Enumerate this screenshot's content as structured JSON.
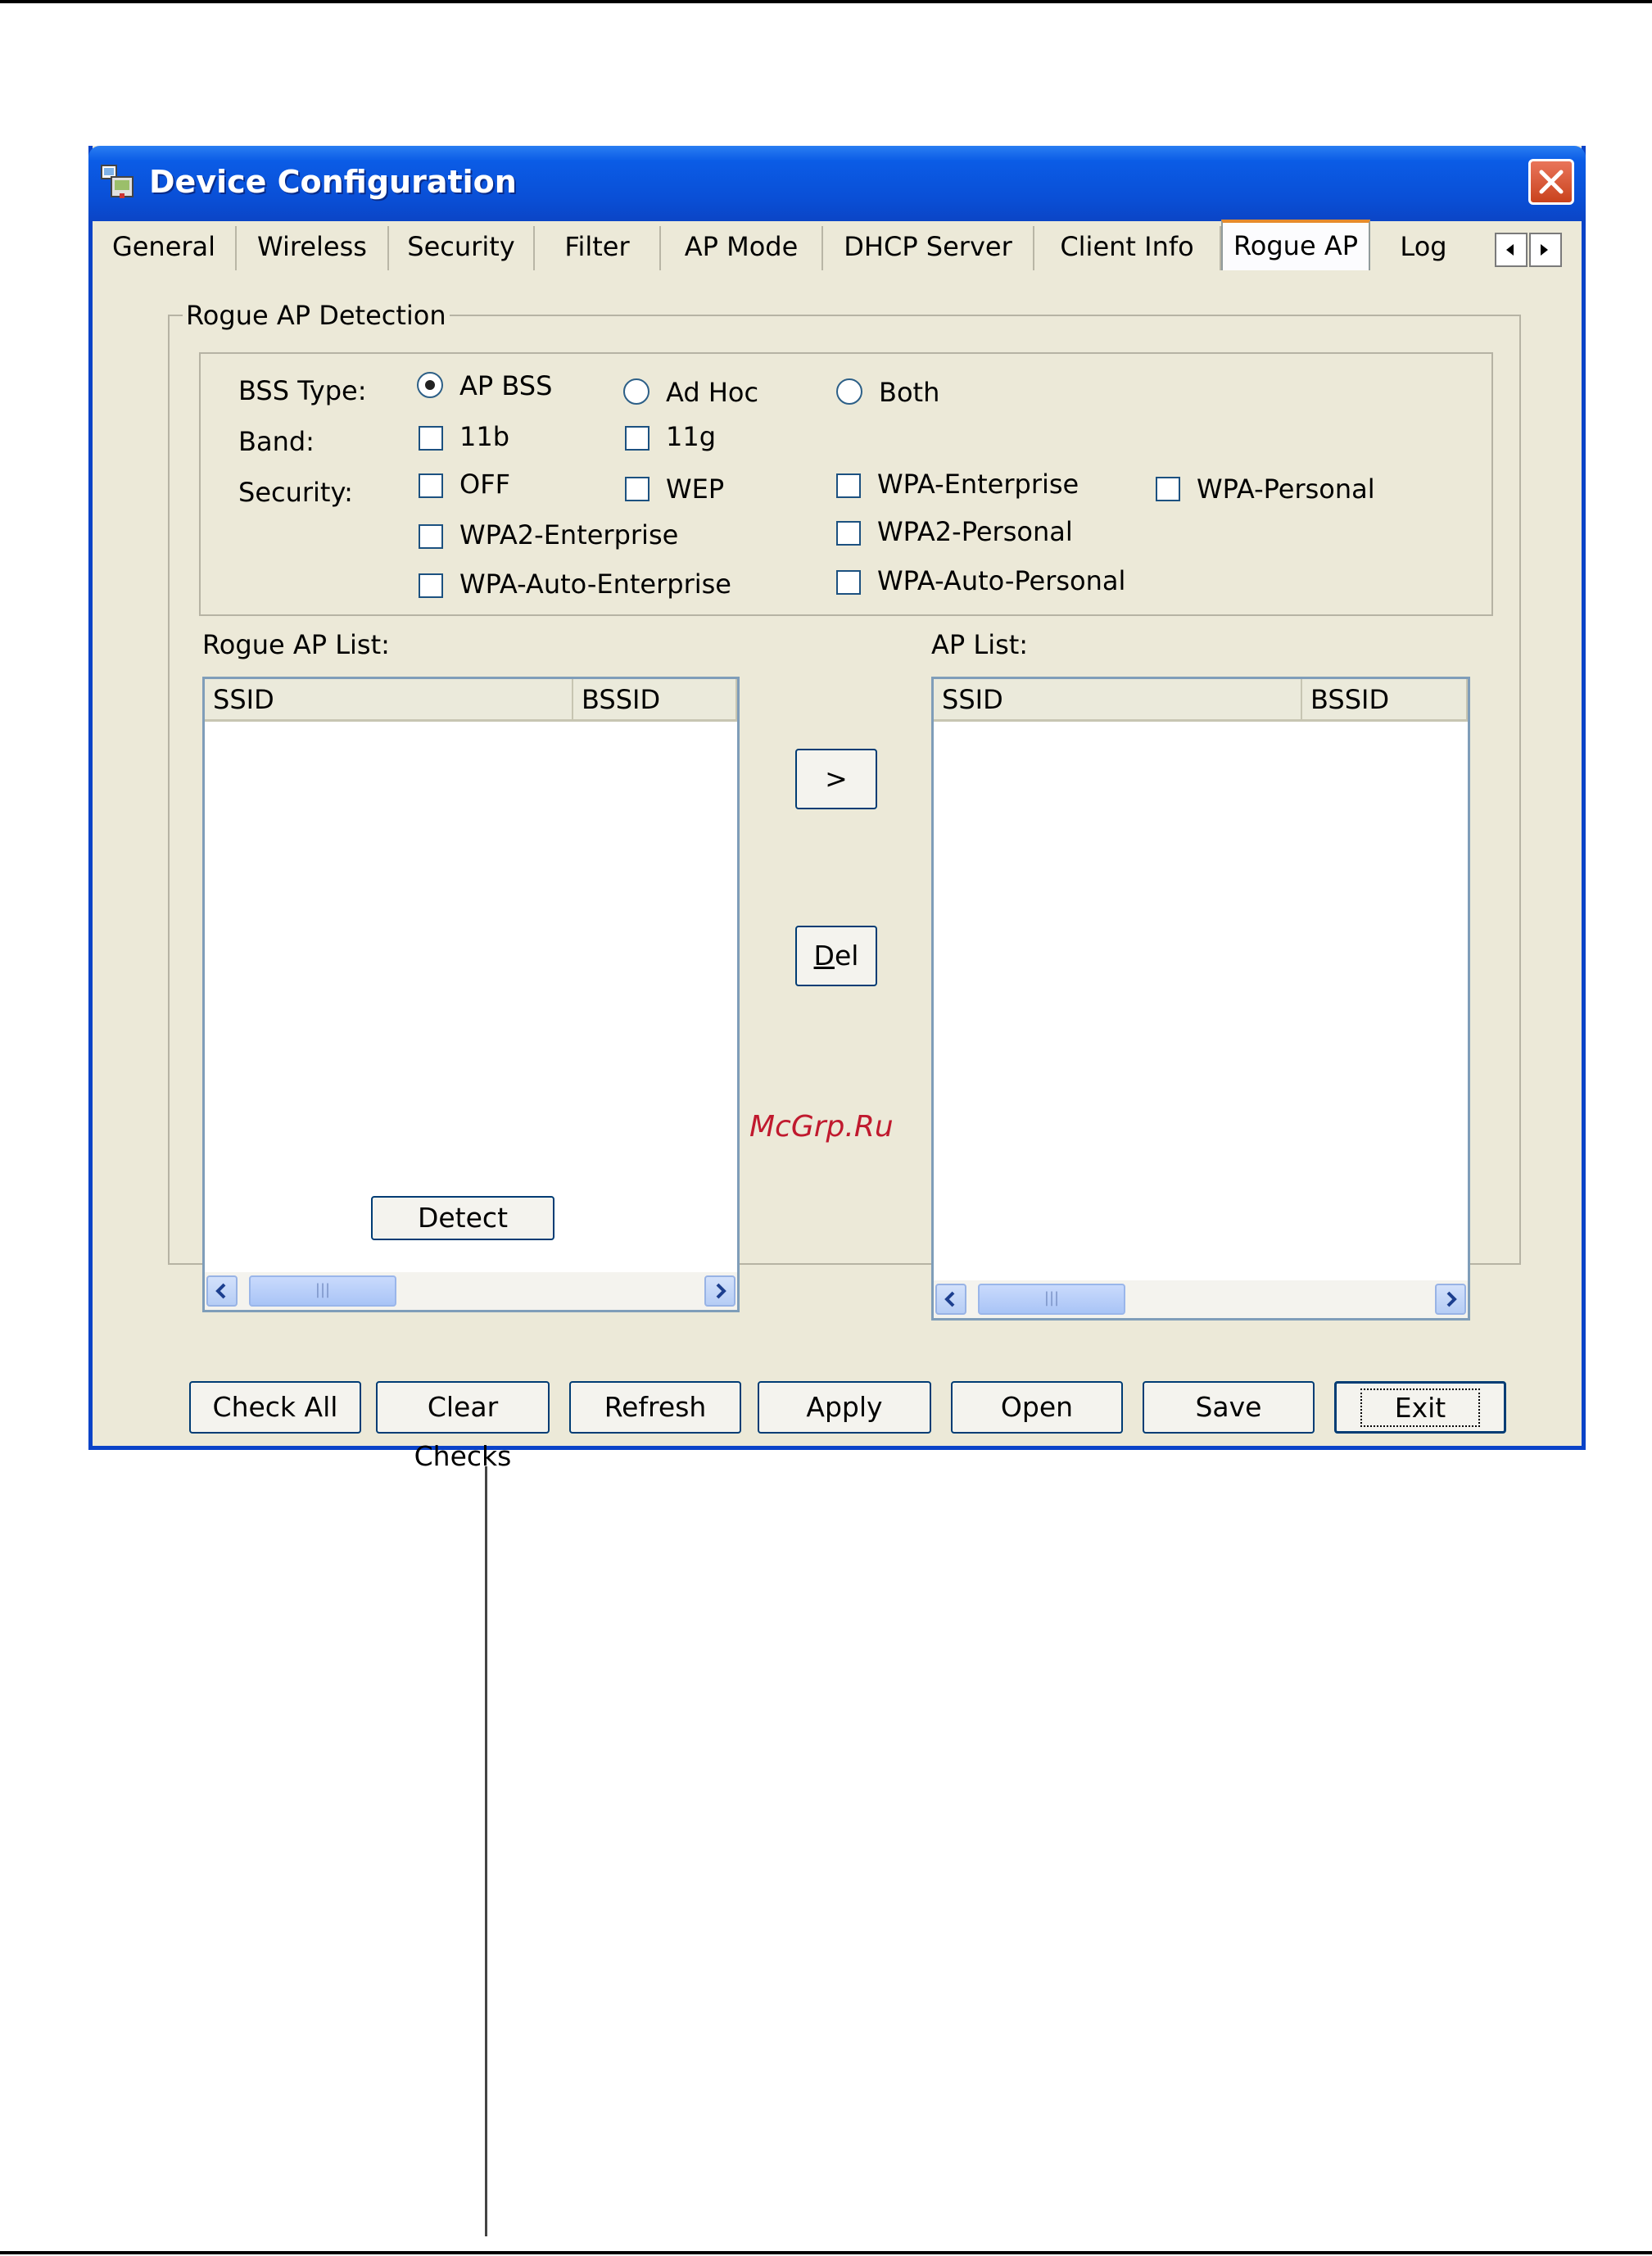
{
  "window": {
    "title": "Device Configuration"
  },
  "tabs": [
    {
      "label": "General"
    },
    {
      "label": "Wireless"
    },
    {
      "label": "Security"
    },
    {
      "label": "Filter"
    },
    {
      "label": "AP Mode"
    },
    {
      "label": "DHCP Server"
    },
    {
      "label": "Client Info"
    },
    {
      "label": "Rogue AP",
      "active": true
    },
    {
      "label": "Log"
    }
  ],
  "detection": {
    "group_title": "Rogue AP Detection",
    "bss_type": {
      "label": "BSS Type:",
      "options": [
        {
          "label": "AP BSS",
          "selected": true
        },
        {
          "label": "Ad Hoc",
          "selected": false
        },
        {
          "label": "Both",
          "selected": false
        }
      ]
    },
    "band": {
      "label": "Band:",
      "options": [
        {
          "label": "11b",
          "checked": false
        },
        {
          "label": "11g",
          "checked": false
        }
      ]
    },
    "security": {
      "label": "Security:",
      "options": [
        {
          "label": "OFF",
          "checked": false
        },
        {
          "label": "WEP",
          "checked": false
        },
        {
          "label": "WPA-Enterprise",
          "checked": false
        },
        {
          "label": "WPA-Personal",
          "checked": false
        },
        {
          "label": "WPA2-Enterprise",
          "checked": false
        },
        {
          "label": "WPA2-Personal",
          "checked": false
        },
        {
          "label": "WPA-Auto-Enterprise",
          "checked": false
        },
        {
          "label": "WPA-Auto-Personal",
          "checked": false
        }
      ]
    }
  },
  "rogue_list": {
    "label": "Rogue AP List:",
    "columns": [
      "SSID",
      "BSSID"
    ]
  },
  "ap_list": {
    "label": "AP List:",
    "columns": [
      "SSID",
      "BSSID"
    ]
  },
  "buttons": {
    "move": ">",
    "del_pre": "",
    "del_acc": "D",
    "del_post": "el",
    "detect": "Detect",
    "check_all": "Check All",
    "clear_checks": "Clear Checks",
    "refresh": "Refresh",
    "apply": "Apply",
    "open": "Open",
    "save": "Save",
    "exit": "Exit"
  },
  "scroll_thumb_grip": "|||",
  "watermark": "McGrp.Ru"
}
